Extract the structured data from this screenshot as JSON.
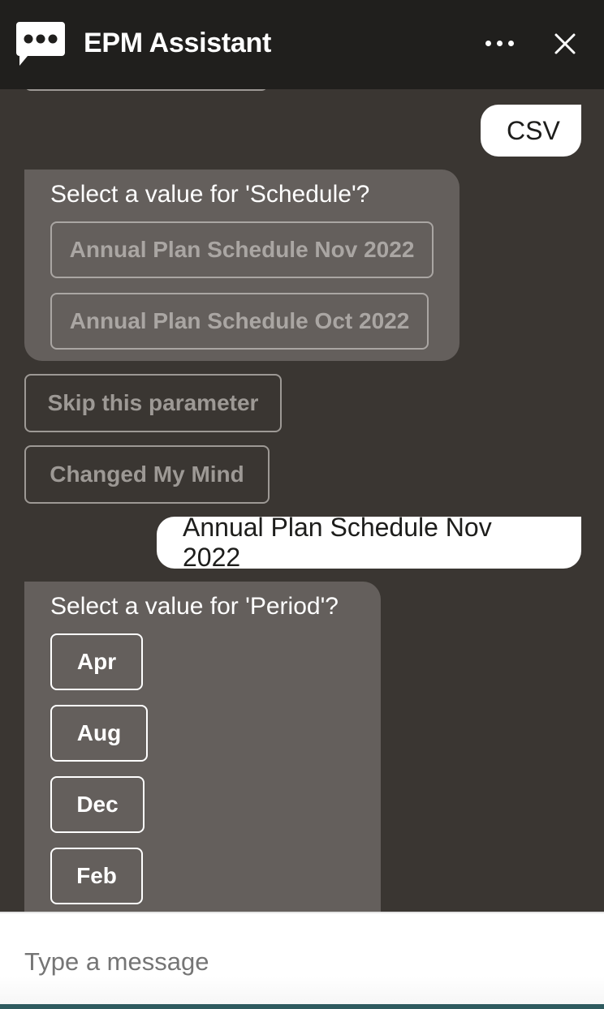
{
  "header": {
    "title": "EPM Assistant",
    "logo_icon": "chat-bubble-dots-icon",
    "more_icon": "more-horizontal-icon",
    "close_icon": "close-icon"
  },
  "conversation": {
    "user_messages": [
      "CSV",
      "Annual Plan Schedule Nov 2022"
    ],
    "schedule_card": {
      "prompt": "Select a value for 'Schedule'?",
      "options": [
        "Annual Plan Schedule Nov 2022",
        "Annual Plan Schedule Oct 2022"
      ]
    },
    "actions": {
      "skip_label": "Skip this parameter",
      "changed_mind_label": "Changed My Mind"
    },
    "period_card": {
      "prompt": "Select a value for 'Period'?",
      "options": [
        "Apr",
        "Aug",
        "Dec",
        "Feb"
      ]
    }
  },
  "composer": {
    "placeholder": "Type a message",
    "value": ""
  }
}
